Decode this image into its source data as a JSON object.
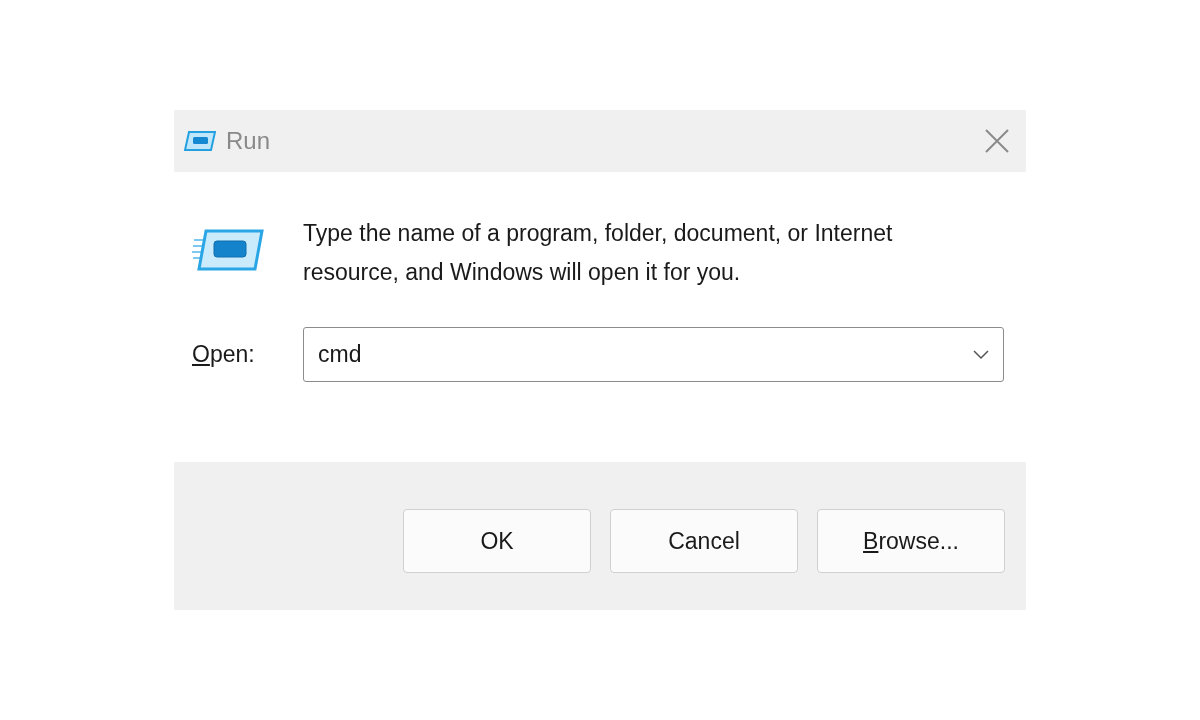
{
  "window": {
    "title": "Run"
  },
  "message": "Type the name of a program, folder, document, or Internet resource, and Windows will open it for you.",
  "open_field": {
    "label": {
      "accel": "O",
      "rest": "pen:"
    },
    "value": "cmd"
  },
  "buttons": [
    {
      "label": {
        "rest": "OK"
      }
    },
    {
      "label": {
        "rest": "Cancel"
      }
    },
    {
      "label": {
        "accel": "B",
        "rest": "rowse..."
      }
    }
  ]
}
